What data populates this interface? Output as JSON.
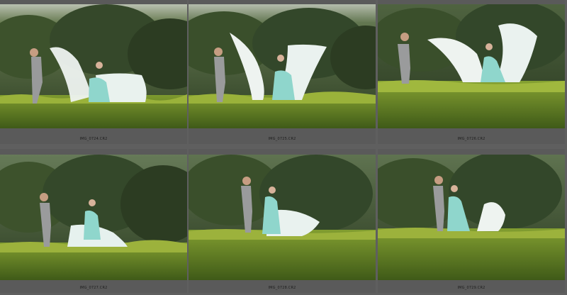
{
  "grid": {
    "thumbnails": [
      {
        "caption": "IMG_0724.CR2"
      },
      {
        "caption": "IMG_0725.CR2"
      },
      {
        "caption": "IMG_0726.CR2"
      },
      {
        "caption": "IMG_0727.CR2"
      },
      {
        "caption": "IMG_0728.CR2"
      },
      {
        "caption": "IMG_0729.CR2"
      }
    ]
  }
}
